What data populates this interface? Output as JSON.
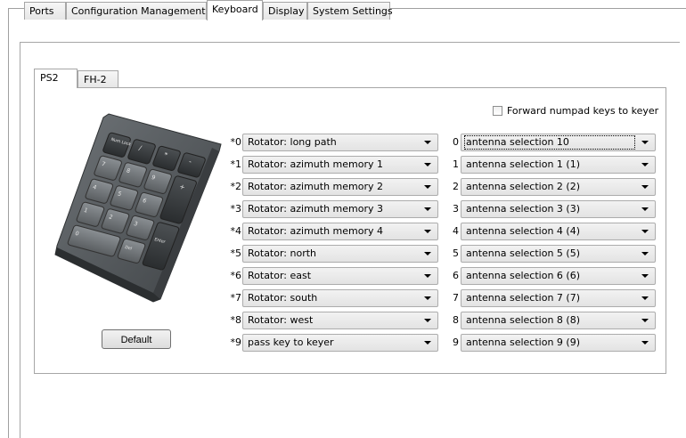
{
  "tabs": [
    "Ports",
    "Configuration Management",
    "Keyboard",
    "Display",
    "System Settings"
  ],
  "active_tab": "Keyboard",
  "inner_tabs": [
    "PS2",
    "FH-2"
  ],
  "active_inner_tab": "PS2",
  "forward_numpad": {
    "label": "Forward numpad keys to keyer",
    "checked": false
  },
  "default_button": "Default",
  "left_rows": [
    {
      "label": "*0",
      "value": "Rotator: long path"
    },
    {
      "label": "*1",
      "value": "Rotator: azimuth memory 1"
    },
    {
      "label": "*2",
      "value": "Rotator: azimuth memory 2"
    },
    {
      "label": "*3",
      "value": "Rotator: azimuth memory 3"
    },
    {
      "label": "*4",
      "value": "Rotator: azimuth memory 4"
    },
    {
      "label": "*5",
      "value": "Rotator: north"
    },
    {
      "label": "*6",
      "value": "Rotator: east"
    },
    {
      "label": "*7",
      "value": "Rotator: south"
    },
    {
      "label": "*8",
      "value": "Rotator: west"
    },
    {
      "label": "*9",
      "value": "pass key to keyer"
    }
  ],
  "right_rows": [
    {
      "label": "0",
      "value": "antenna selection 10"
    },
    {
      "label": "1",
      "value": "antenna selection 1 (1)"
    },
    {
      "label": "2",
      "value": "antenna selection 2 (2)"
    },
    {
      "label": "3",
      "value": "antenna selection 3 (3)"
    },
    {
      "label": "4",
      "value": "antenna selection 4 (4)"
    },
    {
      "label": "5",
      "value": "antenna selection 5 (5)"
    },
    {
      "label": "6",
      "value": "antenna selection 6 (6)"
    },
    {
      "label": "7",
      "value": "antenna selection 7 (7)"
    },
    {
      "label": "8",
      "value": "antenna selection 8 (8)"
    },
    {
      "label": "9",
      "value": "antenna selection 9 (9)"
    }
  ],
  "keypad_image": {
    "keys": [
      "Num Lock",
      "/",
      "*",
      "-",
      "7",
      "8",
      "9",
      "+",
      "4",
      "5",
      "6",
      "1",
      "2",
      "3",
      "Enter",
      "0",
      "Del"
    ]
  }
}
